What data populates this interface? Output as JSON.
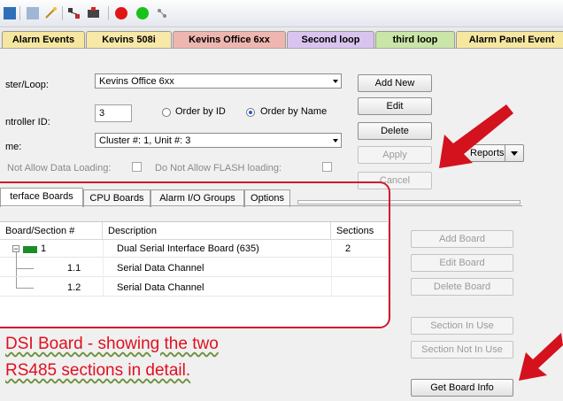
{
  "colors": {
    "accent_red": "#d1182b",
    "annotation_red": "#e0101f",
    "selected_radio": "#1f5fd6"
  },
  "toolbar": {
    "icons": [
      "grid-icon",
      "list-icon",
      "wand-icon",
      "network-icon",
      "alarm-icon",
      "red-circle-icon",
      "green-circle-icon",
      "small-node-icon"
    ]
  },
  "tabs": [
    {
      "label": "Alarm Events",
      "color": "#f6e7a0"
    },
    {
      "label": "Kevins 508i",
      "color": "#f7e8a8"
    },
    {
      "label": "Kevins Office 6xx",
      "color": "#efb6b0"
    },
    {
      "label": "Second loop",
      "color": "#d9c4ef"
    },
    {
      "label": "third loop",
      "color": "#c9e5a7"
    },
    {
      "label": "Alarm Panel Event",
      "color": "#f6e7a0"
    }
  ],
  "form": {
    "cluster_label": "ster/Loop:",
    "cluster_value": "Kevins Office 6xx",
    "controller_label": "ntroller ID:",
    "controller_value": "3",
    "order_by_id": "Order by ID",
    "order_by_name": "Order by Name",
    "name_label": "me:",
    "name_value": "Cluster #: 1, Unit #: 3",
    "no_data_loading": "Not Allow Data Loading:",
    "no_flash_loading": "Do Not Allow FLASH loading:"
  },
  "buttons": {
    "add_new": "Add New",
    "edit": "Edit",
    "delete": "Delete",
    "apply": "Apply",
    "cancel": "Cancel",
    "reports": "Reports",
    "add_board": "Add Board",
    "edit_board": "Edit Board",
    "delete_board": "Delete Board",
    "section_in_use": "Section In Use",
    "section_not_in_use": "Section Not In Use",
    "get_board_info": "Get Board Info"
  },
  "subtabs": [
    "terface Boards",
    "CPU Boards",
    "Alarm I/O Groups",
    "Options"
  ],
  "grid": {
    "headers": [
      "Board/Section #",
      "Description",
      "Sections"
    ],
    "rows": [
      {
        "id": "1",
        "desc": "Dual Serial Interface Board (635)",
        "sections": "2"
      },
      {
        "id": "1.1",
        "desc": "Serial Data Channel",
        "sections": ""
      },
      {
        "id": "1.2",
        "desc": "Serial Data Channel",
        "sections": ""
      }
    ]
  },
  "annotation": {
    "line1": "DSI Board - showing the two",
    "line2": "RS485 sections in detail."
  }
}
